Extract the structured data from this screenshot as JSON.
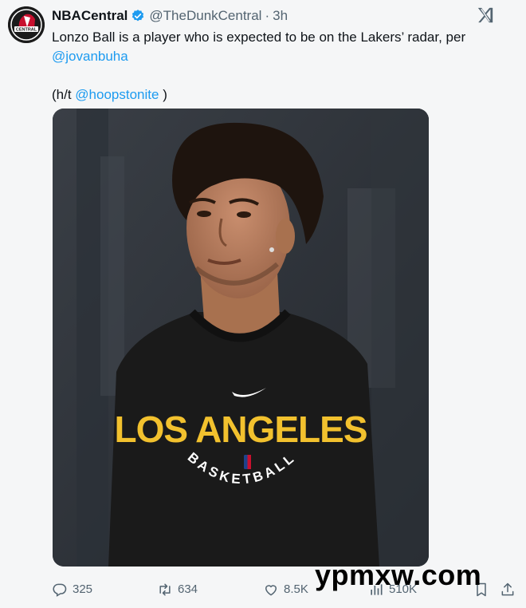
{
  "tweet": {
    "display_name": "NBACentral",
    "verified": true,
    "handle": "@TheDunkCentral",
    "separator": "·",
    "time": "3h",
    "text_line1": "Lonzo Ball is a player who is expected to be on the Lakers’ radar, per",
    "mention1": "@jovanbuha",
    "ht_prefix": "(h/t ",
    "mention2": "@hoopstonite",
    "ht_suffix": " )",
    "media": {
      "shirt_text": "LOS ANGELES",
      "shirt_subtext": "BASKETBALL"
    }
  },
  "avatar": {
    "text": "CENTRAL"
  },
  "actions": {
    "replies": "325",
    "reposts": "634",
    "likes": "8.5K",
    "views": "510K"
  },
  "watermark": "ypmxw.com",
  "colors": {
    "accent": "#1d9bf0",
    "text": "#0f1419",
    "muted": "#536471",
    "background": "#f5f6f7",
    "shirt_yellow": "#f2c12e"
  },
  "icons": [
    "verified-badge-icon",
    "x-logo-icon",
    "reply-icon",
    "repost-icon",
    "like-icon",
    "views-icon",
    "bookmark-icon",
    "share-icon"
  ]
}
